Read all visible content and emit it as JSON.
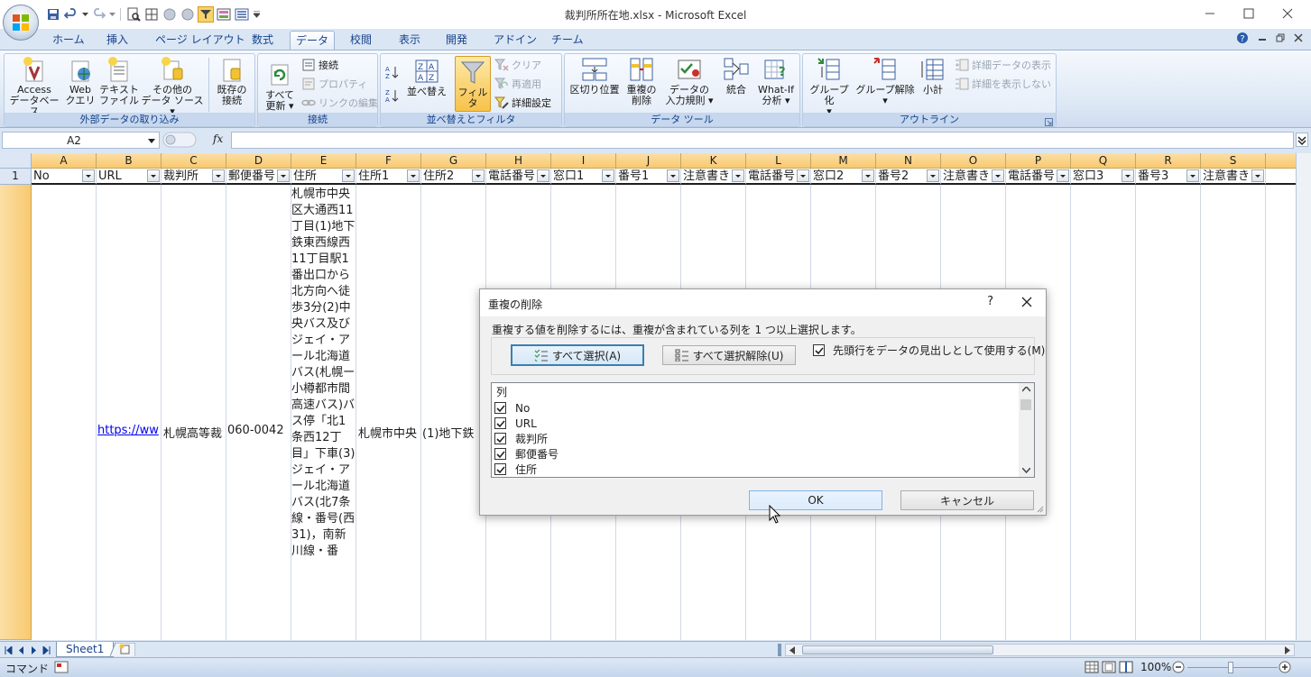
{
  "window": {
    "title": "裁判所所在地.xlsx - Microsoft Excel",
    "app_icon": "office-orb-icon"
  },
  "ribbon_tabs": [
    {
      "label": "ホーム",
      "active": false
    },
    {
      "label": "挿入",
      "active": false
    },
    {
      "label": "ページ レイアウト",
      "active": false
    },
    {
      "label": "数式",
      "active": false
    },
    {
      "label": "データ",
      "active": true
    },
    {
      "label": "校閲",
      "active": false
    },
    {
      "label": "表示",
      "active": false
    },
    {
      "label": "開発",
      "active": false
    },
    {
      "label": "アドイン",
      "active": false
    },
    {
      "label": "チーム",
      "active": false
    }
  ],
  "ribbon": {
    "external": {
      "label": "外部データの取り込み",
      "access": [
        "Access",
        "データベース"
      ],
      "web": [
        "Web",
        "クエリ"
      ],
      "text": [
        "テキスト",
        "ファイル"
      ],
      "other": [
        "その他の",
        "データ ソース"
      ],
      "existing": [
        "既存の",
        "接続"
      ]
    },
    "connections": {
      "label": "接続",
      "refresh": [
        "すべて",
        "更新"
      ],
      "connections": "接続",
      "properties": "プロパティ",
      "edit_links": "リンクの編集"
    },
    "sort_filter": {
      "label": "並べ替えとフィルタ",
      "sort": "並べ替え",
      "filter": "フィルタ",
      "clear": "クリア",
      "reapply": "再適用",
      "advanced": "詳細設定"
    },
    "data_tools": {
      "label": "データ ツール",
      "text_to_columns": "区切り位置",
      "remove_duplicates": [
        "重複の",
        "削除"
      ],
      "validation": [
        "データの",
        "入力規則"
      ],
      "consolidate": "統合",
      "whatif": [
        "What-If",
        "分析"
      ]
    },
    "outline": {
      "label": "アウトライン",
      "group": "グループ化",
      "ungroup": "グループ解除",
      "subtotal": "小計",
      "show_detail": "詳細データの表示",
      "hide_detail": "詳細を表示しない"
    }
  },
  "formula_bar": {
    "name_box": "A2",
    "fx": "fx",
    "formula": ""
  },
  "grid": {
    "columns": [
      "A",
      "B",
      "C",
      "D",
      "E",
      "F",
      "G",
      "H",
      "I",
      "J",
      "K",
      "L",
      "M",
      "N",
      "O",
      "P",
      "Q",
      "R",
      "S"
    ],
    "header_row_number": "1",
    "headers": [
      "No",
      "URL",
      "裁判所",
      "郵便番号",
      "住所",
      "住所1",
      "住所2",
      "電話番号",
      "窓口1",
      "番号1",
      "注意書き",
      "電話番号",
      "窓口2",
      "番号2",
      "注意書き",
      "電話番号",
      "窓口3",
      "番号3",
      "注意書き"
    ],
    "row2": {
      "url": "https://ww",
      "court": "札幌高等裁",
      "postal": "060-0042",
      "address": "札幌市中央区大通西11丁目(1)地下鉄東西線西11丁目駅1番出口から北方向へ徒歩3分(2)中央バス及びジェイ・アール北海道バス(札幌ー小樽都市間高速バス)バス停「北1条西12丁目」下車(3)ジェイ・アール北海道バス(北7条線・番号(西31)，南新川線・番",
      "address1": "札幌市中央",
      "address2": "(1)地下鉄"
    }
  },
  "sheet_tabs": [
    "Sheet1"
  ],
  "status": {
    "mode": "コマンド",
    "zoom": "100%"
  },
  "dialog": {
    "title": "重複の削除",
    "help": "?",
    "instruction": "重複する値を削除するには、重複が含まれている列を 1 つ以上選択します。",
    "select_all": "すべて選択(A)",
    "unselect_all": "すべて選択解除(U)",
    "has_headers_label": "先頭行をデータの見出しとして使用する(M)",
    "has_headers_checked": true,
    "list_header": "列",
    "columns": [
      {
        "label": "No",
        "checked": true
      },
      {
        "label": "URL",
        "checked": true
      },
      {
        "label": "裁判所",
        "checked": true
      },
      {
        "label": "郵便番号",
        "checked": true
      },
      {
        "label": "住所",
        "checked": true
      }
    ],
    "ok": "OK",
    "cancel": "キャンセル"
  }
}
